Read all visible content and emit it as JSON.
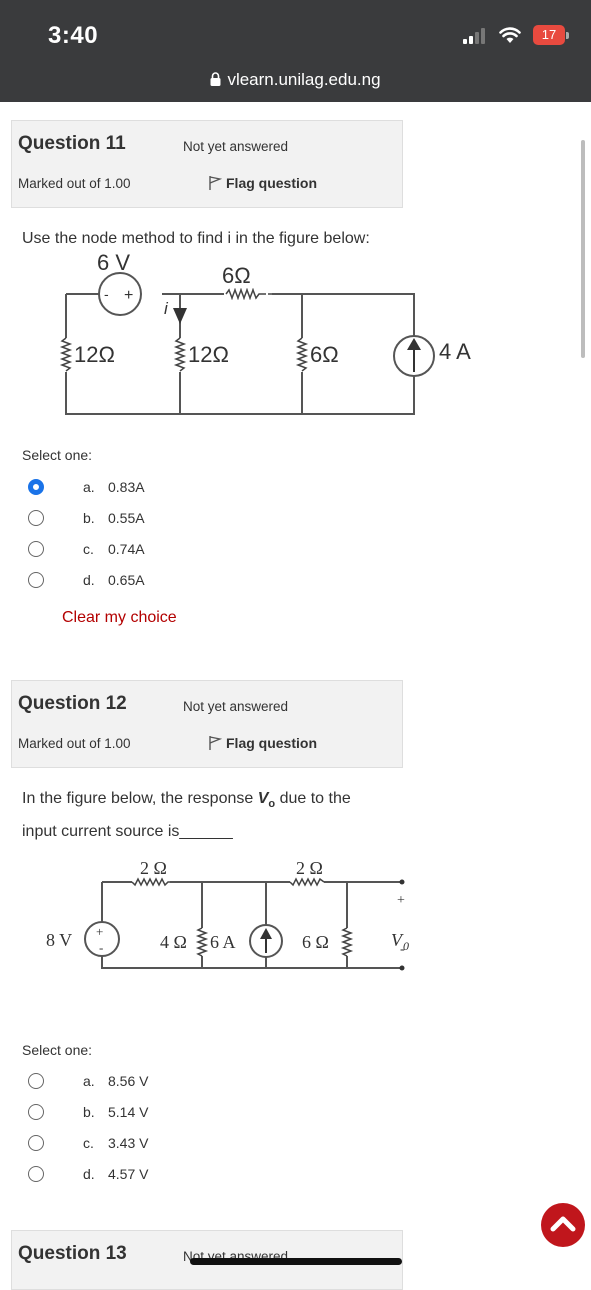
{
  "status_bar": {
    "time": "3:40",
    "battery": "17",
    "url": "vlearn.unilag.edu.ng"
  },
  "questions": [
    {
      "number": "Question 11",
      "state": "Not yet answered",
      "marked": "Marked out of 1.00",
      "flag": "Flag question",
      "text": "Use the node method to find i in the figure below:",
      "select_label": "Select one:",
      "options": [
        {
          "letter": "a.",
          "text": "0.83A",
          "selected": true
        },
        {
          "letter": "b.",
          "text": "0.55A",
          "selected": false
        },
        {
          "letter": "c.",
          "text": "0.74A",
          "selected": false
        },
        {
          "letter": "d.",
          "text": "0.65A",
          "selected": false
        }
      ],
      "clear": "Clear my choice",
      "figure": {
        "voltage_source": "6 V",
        "polarity_minus": "-",
        "polarity_plus": "+",
        "current_label": "i",
        "top_resistor": "6Ω",
        "r1": "12Ω",
        "r2": "12Ω",
        "r3": "6Ω",
        "current_source": "4 A"
      }
    },
    {
      "number": "Question 12",
      "state": "Not yet answered",
      "marked": "Marked out of 1.00",
      "flag": "Flag question",
      "text_part1": "In the figure below, the response ",
      "text_var": "V",
      "text_sub": "o",
      "text_part2": " due to the",
      "text_line2": "input current source is______",
      "select_label": "Select one:",
      "options": [
        {
          "letter": "a.",
          "text": "8.56 V",
          "selected": false
        },
        {
          "letter": "b.",
          "text": "5.14 V",
          "selected": false
        },
        {
          "letter": "c.",
          "text": "3.43 V",
          "selected": false
        },
        {
          "letter": "d.",
          "text": "4.57 V",
          "selected": false
        }
      ],
      "figure": {
        "voltage_source": "8 V",
        "plus": "+",
        "minus": "-",
        "top_resistor_1": "2 Ω",
        "top_resistor_2": "2 Ω",
        "r_mid": "4 Ω",
        "current_source": "6 A",
        "r_right": "6 Ω",
        "out_plus": "+",
        "out_minus": "-",
        "out_label": "V",
        "out_sub": "0"
      }
    },
    {
      "number": "Question 13",
      "state": "Not yet answered"
    }
  ]
}
